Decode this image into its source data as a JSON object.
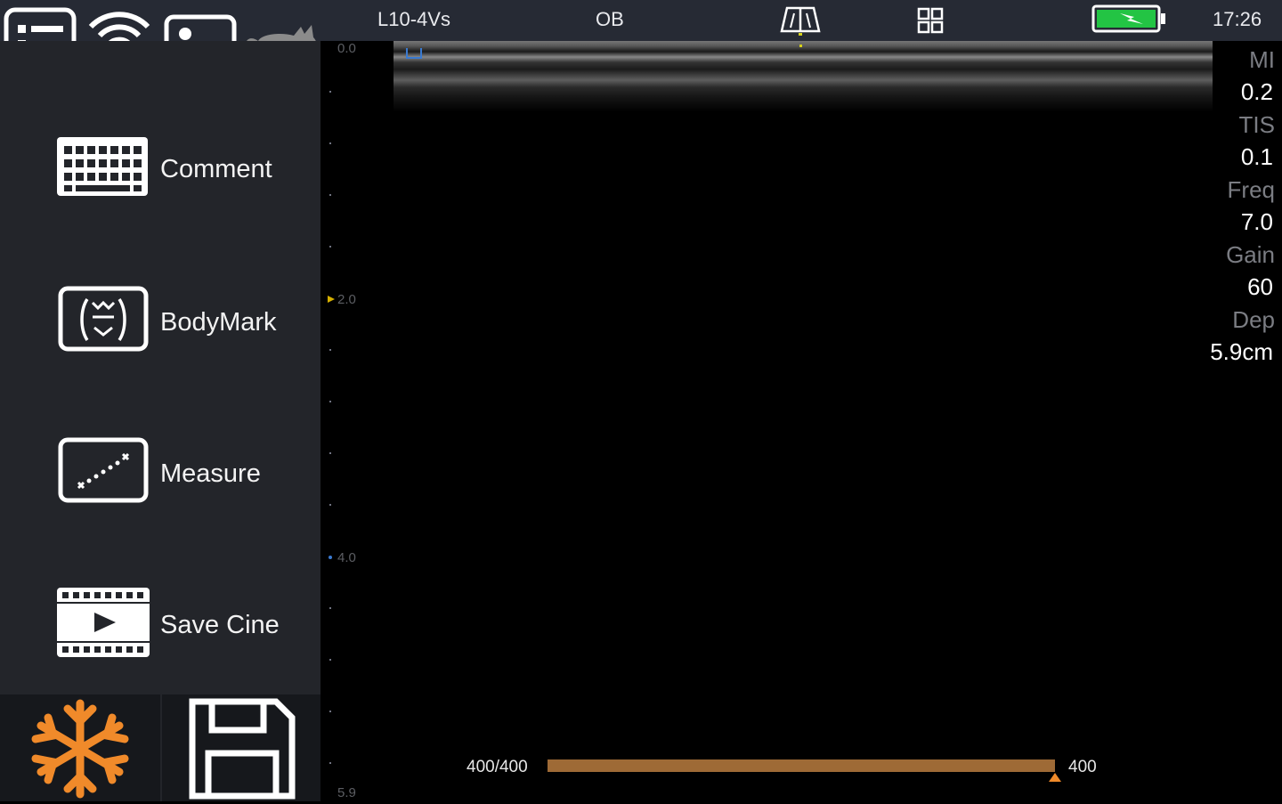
{
  "topbar": {
    "probe": "L10-4Vs",
    "preset": "OB",
    "time": "17:26",
    "icons": {
      "menu": "list-menu-icon",
      "probe_wifi": "wireless-probe-icon",
      "gallery": "image-gallery-icon",
      "animal": "cat-icon",
      "beam": "beam-steer-icon",
      "layout": "quad-layout-icon",
      "battery": "battery-charging-icon"
    }
  },
  "sidebar": {
    "items": [
      {
        "label": "Comment",
        "icon": "keyboard-icon"
      },
      {
        "label": "BodyMark",
        "icon": "bodymark-icon"
      },
      {
        "label": "Measure",
        "icon": "measure-icon"
      },
      {
        "label": "Save Cine",
        "icon": "film-play-icon"
      }
    ]
  },
  "bottom": {
    "freeze_icon": "snowflake-icon",
    "save_icon": "floppy-disk-icon"
  },
  "image": {
    "depth_labels": [
      "0.0",
      "2.0",
      "4.0",
      "5.9"
    ]
  },
  "params": {
    "mi_label": "MI",
    "mi_value": "0.2",
    "tis_label": "TIS",
    "tis_value": "0.1",
    "freq_label": "Freq",
    "freq_value": "7.0",
    "gain_label": "Gain",
    "gain_value": "60",
    "dep_label": "Dep",
    "dep_value": "5.9cm"
  },
  "cine": {
    "frame_counter": "400/400",
    "end_frame": "400",
    "progress": 1.0
  },
  "colors": {
    "accent_orange": "#f08a2a",
    "cine_bar": "#9e6a36",
    "probe_green": "#23c444"
  }
}
